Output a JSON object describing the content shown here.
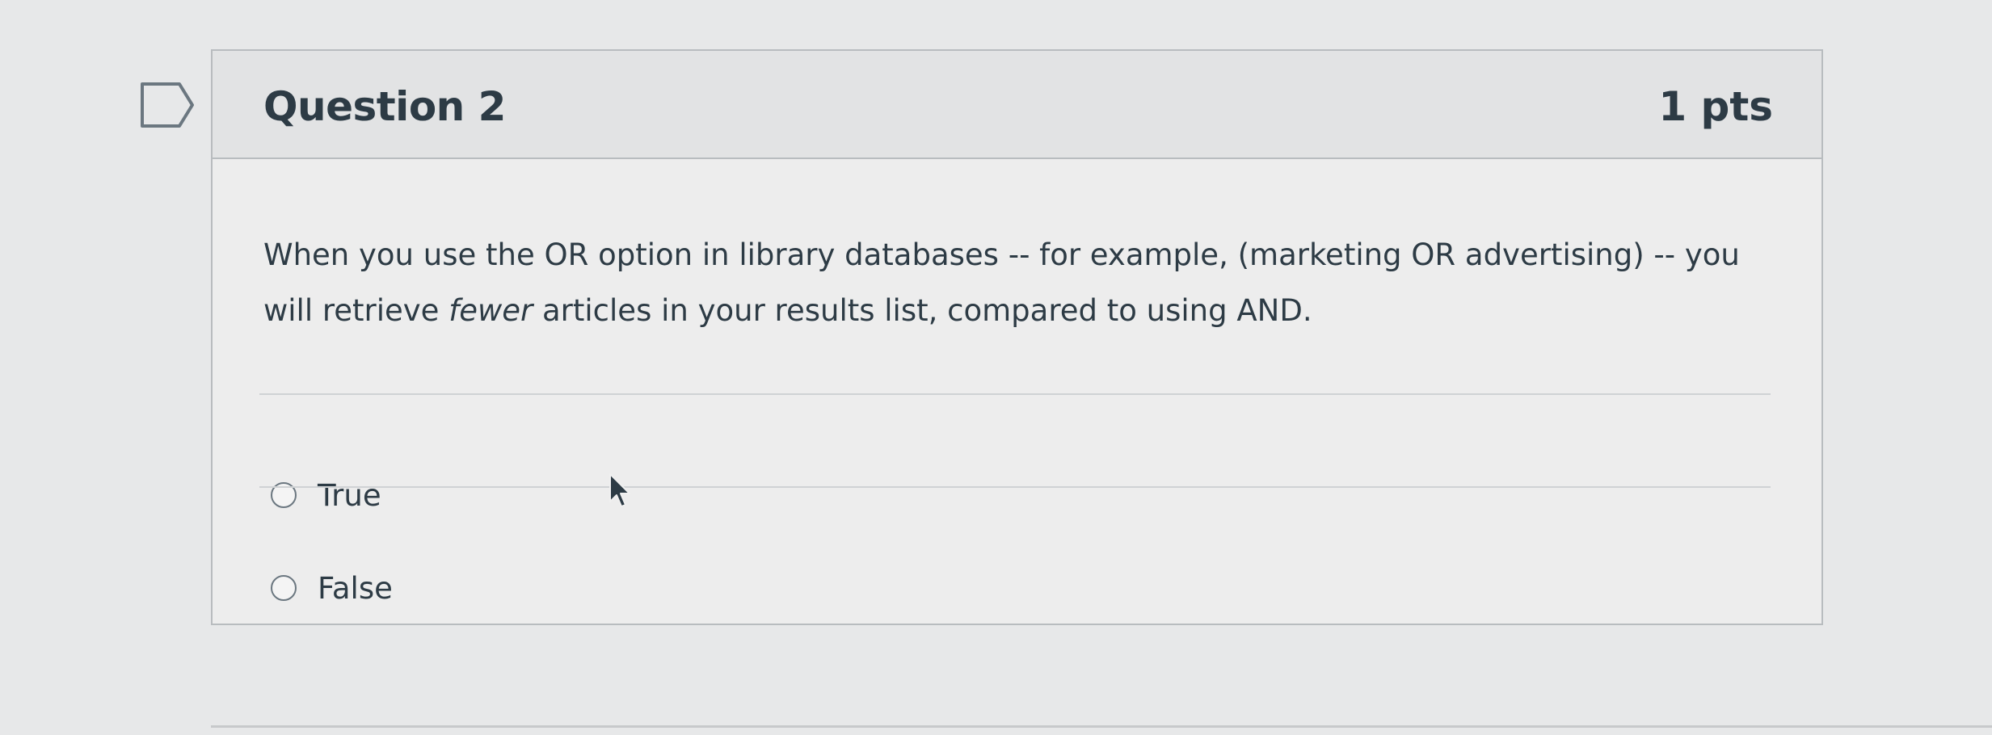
{
  "question": {
    "title": "Question 2",
    "points": "1 pts",
    "text_before_em": "When you use the OR option in library databases -- for example, (marketing OR advertising) -- you will retrieve ",
    "text_em": "fewer",
    "text_after_em": " articles in your results list, compared to using AND.",
    "answers": [
      {
        "label": "True",
        "selected": false
      },
      {
        "label": "False",
        "selected": false
      }
    ]
  },
  "icons": {
    "flag": "flag-outline-icon",
    "cursor": "mouse-pointer-icon",
    "radio": "radio-unselected-icon"
  },
  "colors": {
    "text": "#2d3b45",
    "border": "#b8bcbf",
    "header_bg": "#e2e3e4",
    "body_bg": "#ededed"
  }
}
